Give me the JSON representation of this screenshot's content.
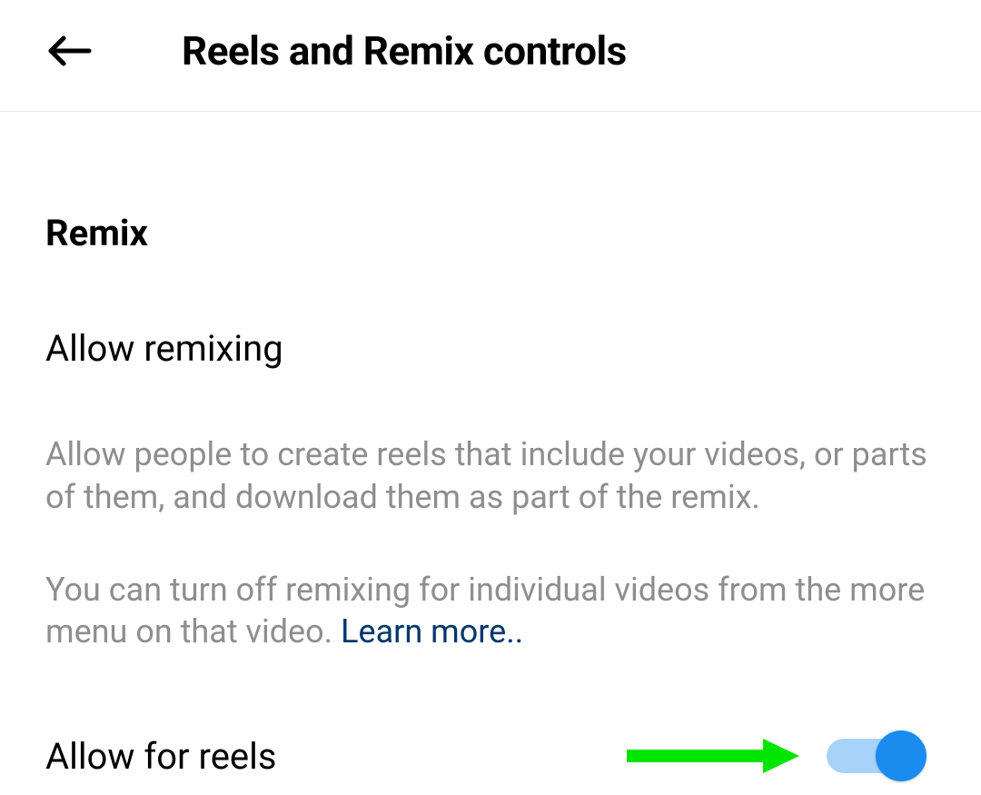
{
  "header": {
    "title": "Reels and Remix controls"
  },
  "section": {
    "heading": "Remix",
    "settingLabel": "Allow remixing",
    "description1": "Allow people to create reels that include your videos, or parts of them, and download them as part of the remix.",
    "description2": "You can turn off remixing for individual videos from the more menu on that video. ",
    "learnMore": "Learn more.."
  },
  "toggleRow": {
    "label": "Allow for reels",
    "state": "on"
  },
  "colors": {
    "toggleTrack": "#a7d3fb",
    "toggleThumb": "#1a8cf0",
    "arrow": "#00e600",
    "link": "#00376b",
    "muted": "#8e8e8e"
  }
}
